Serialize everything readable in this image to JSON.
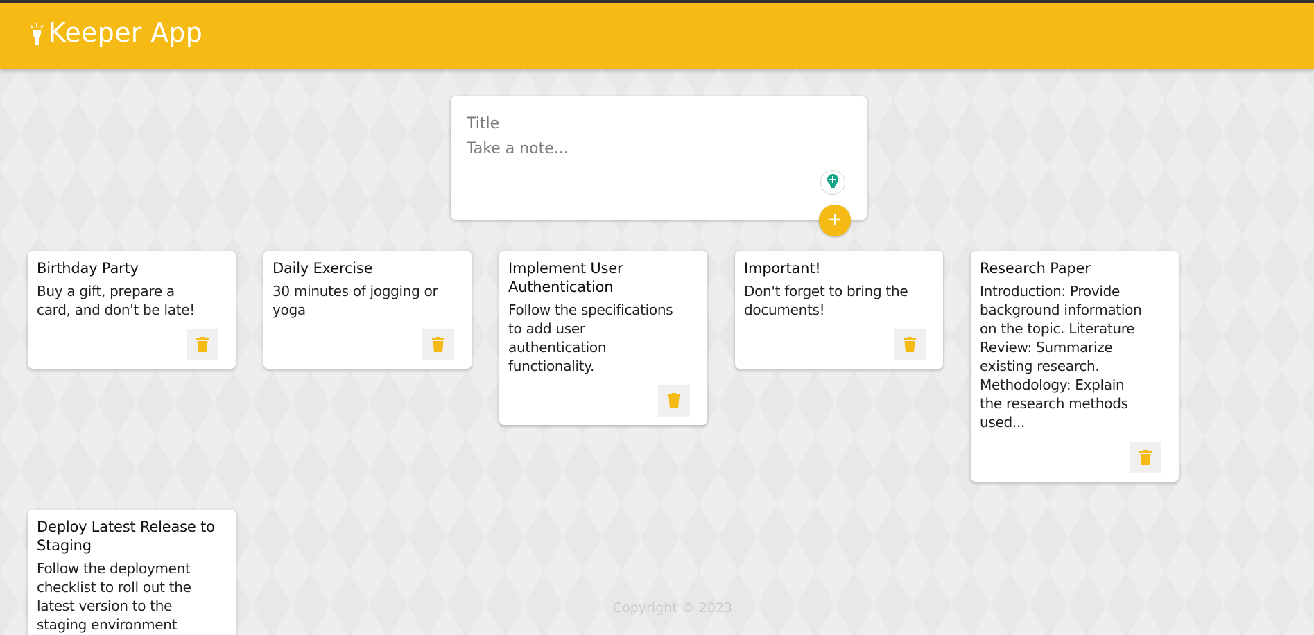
{
  "header": {
    "title": "Keeper App",
    "logo_icon": "highlight-lamp-icon",
    "color": "#f5ba13"
  },
  "create_area": {
    "title_placeholder": "Title",
    "content_placeholder": "Take a note...",
    "bulb_icon": "lightbulb-icon",
    "add_icon": "plus-icon"
  },
  "notes": [
    {
      "title": "Birthday Party",
      "content": "Buy a gift, prepare a\ncard, and don't be late!"
    },
    {
      "title": "Daily Exercise",
      "content": "30 minutes of jogging or\nyoga"
    },
    {
      "title": "Implement User\nAuthentication",
      "content": "Follow the specifications\nto add user\nauthentication\nfunctionality."
    },
    {
      "title": "Important!",
      "content": "Don't forget to bring the\ndocuments!"
    },
    {
      "title": "Research Paper",
      "content": "Introduction: Provide\nbackground information\non the topic. Literature\nReview: Summarize\nexisting research.\nMethodology: Explain\nthe research methods\nused..."
    },
    {
      "title": "Deploy Latest Release to\nStaging",
      "content": "Follow the deployment\nchecklist to roll out the\nlatest version to the\nstaging environment"
    }
  ],
  "delete_icon": "trash-icon",
  "footer": {
    "copyright": "Copyright © 2023"
  },
  "colors": {
    "accent": "#f5ba13",
    "bulb": "#17a589"
  }
}
